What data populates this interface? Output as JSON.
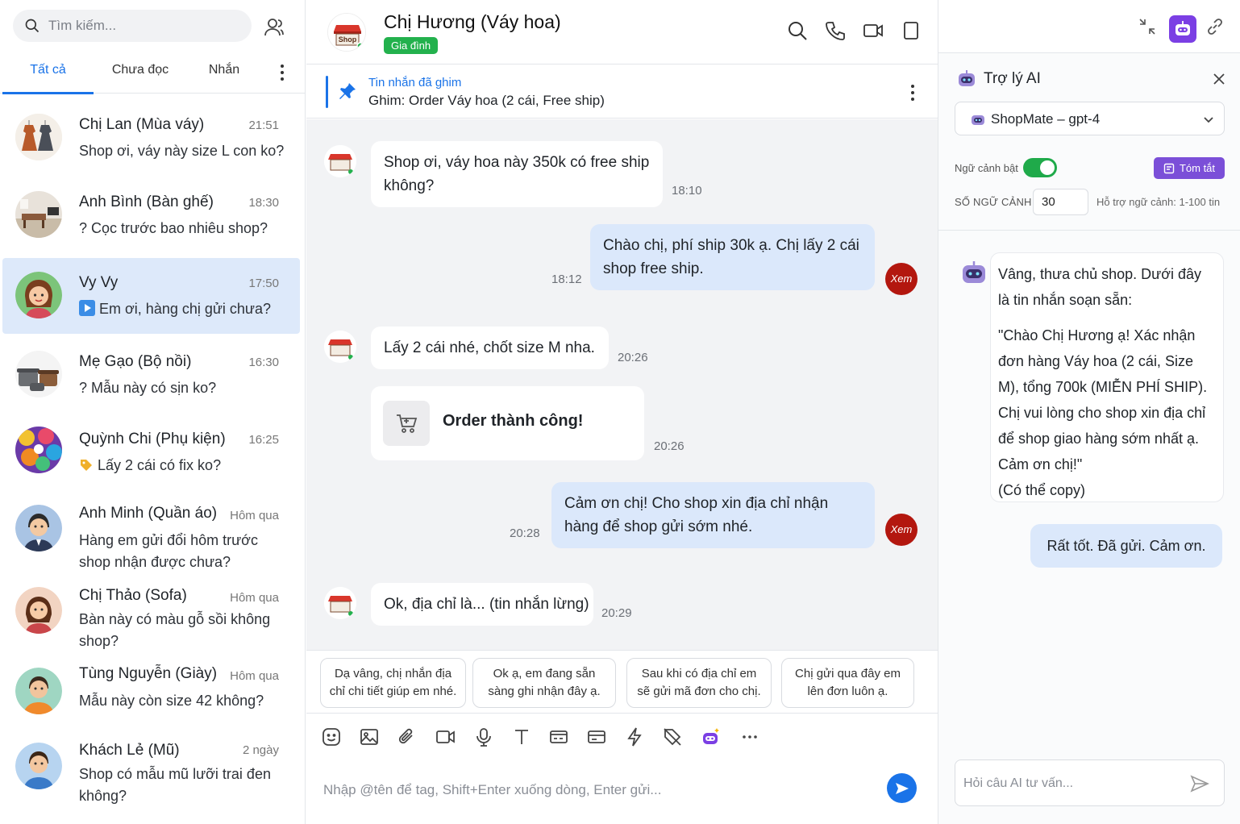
{
  "left": {
    "search_placeholder": "Tìm kiếm...",
    "tabs": [
      {
        "label": "Tất cả",
        "active": true
      },
      {
        "label": "Chưa đọc",
        "active": false
      },
      {
        "label": "Nhắn",
        "active": false
      }
    ],
    "conversations": [
      {
        "name": "Chị Lan (Mùa váy)",
        "time": "21:51",
        "message": "Shop ơi, váy này size L con ko?",
        "avatar": "dress-avatar"
      },
      {
        "name": "Anh Bình (Bàn ghế)",
        "time": "18:30",
        "message": "? Cọc trước bao nhiêu shop?",
        "avatar": "furniture-avatar"
      },
      {
        "name": "Vy Vy",
        "time": "17:50",
        "message": "Em ơi, hàng chị gửi chưa?",
        "avatar": "girl-avatar",
        "active": true
      },
      {
        "name": "Mẹ Gạo (Bộ nồi)",
        "time": "16:30",
        "message": "? Mẫu này có sịn ko?",
        "avatar": "pots-avatar"
      },
      {
        "name": "Quỳnh Chi (Phụ kiện)",
        "time": "16:25",
        "message": "Lấy 2 cái có fix ko?",
        "avatar": "accessories-avatar"
      },
      {
        "name": "Anh Minh (Quần áo)",
        "time": "Hôm qua",
        "message": "Hàng em gửi đổi hôm trước shop nhận được chưa?",
        "avatar": "man-suit-avatar"
      },
      {
        "name": "Chị Thảo (Sofa)",
        "time": "Hôm qua",
        "message": "Bàn này có màu gỗ sồi không shop?",
        "avatar": "woman-avatar"
      },
      {
        "name": "Tùng Nguyễn (Giày)",
        "time": "Hôm qua",
        "message": "Mẫu này còn size 42 không?",
        "avatar": "man-orange-avatar"
      },
      {
        "name": "Khách Lẻ (Mũ)",
        "time": "2 ngày",
        "message": "Shop có mẫu mũ lưỡi trai đen không?",
        "avatar": "man-blue-avatar"
      }
    ]
  },
  "chat": {
    "title": "Chị Hương (Váy hoa)",
    "badge": "Gia đình",
    "avatar_label": "Shop",
    "pinned_label": "Tin nhắn đã ghim",
    "pinned_text": "Ghim: Order Váy hoa (2 cái, Free ship)",
    "messages": [
      {
        "dir": "in",
        "text": "Shop ơi, váy hoa này 350k có free ship không?",
        "time": "18:10"
      },
      {
        "dir": "out",
        "text": "Chào chị, phí ship 30k ạ. Chị lấy 2 cái shop free ship.",
        "time": "18:12",
        "avatar_text": "Xem"
      },
      {
        "dir": "in",
        "text": "Lấy 2 cái nhé, chốt size M nha.",
        "time": "20:26"
      },
      {
        "dir": "card",
        "text": "Order thành công!",
        "time": "20:26"
      },
      {
        "dir": "out",
        "text": "Cảm ơn chị! Cho shop xin địa chỉ nhận hàng để shop gửi sớm nhé.",
        "time": "20:28",
        "avatar_text": "Xem"
      },
      {
        "dir": "in",
        "text": "Ok, địa chỉ là... (tin nhắn lừng)",
        "time": "20:29"
      }
    ],
    "quick_replies": [
      "Dạ vâng, chị nhắn địa chỉ chi tiết giúp em nhé.",
      "Ok ạ, em đang sẵn sàng ghi nhận đây ạ.",
      "Sau khi có địa chỉ em sẽ gửi mã đơn cho chị.",
      "Chị gửi qua đây em lên đơn luôn ạ."
    ],
    "composer_placeholder": "Nhập @tên để tag, Shift+Enter xuống dòng, Enter gửi...",
    "toolbar_icons": [
      "emoji-icon",
      "image-icon",
      "attach-icon",
      "video-icon",
      "mic-icon",
      "text-format-icon",
      "card-icon",
      "payment-icon",
      "lightning-icon",
      "no-tag-icon",
      "ai-bot-icon",
      "more-icon"
    ]
  },
  "ai": {
    "title": "Trợ lý AI",
    "model": "ShopMate – gpt-4",
    "context_label": "Ngữ cảnh bật",
    "context_on": true,
    "summary_button": "Tóm tắt",
    "context_count_label": "SỐ NGỮ CẢNH",
    "context_count": "30",
    "context_hint": "Hỗ trợ ngữ cảnh: 1-100 tin",
    "reply_intro": "Vâng, thưa chủ shop. Dưới đây là tin nhắn soạn sẵn:",
    "reply_draft": "\"Chào Chị Hương ạ! Xác nhận đơn hàng Váy hoa (2 cái, Size M), tổng 700k (MIỄN PHÍ SHIP). Chị vui lòng cho shop xin địa chỉ để shop giao hàng sớm nhất ạ. Cảm ơn chị!\"",
    "reply_note": "(Có thể copy)",
    "user_reply": "Rất tốt. Đã gửi. Cảm ơn.",
    "input_placeholder": "Hỏi câu AI tư vấn..."
  },
  "colors": {
    "accent": "#1a73e8",
    "badge_green": "#23b14d",
    "ai_purple": "#7b3fe4",
    "active_row": "#dde9fa",
    "out_bubble": "#dbe8fb",
    "self_avatar": "#b3170f"
  }
}
